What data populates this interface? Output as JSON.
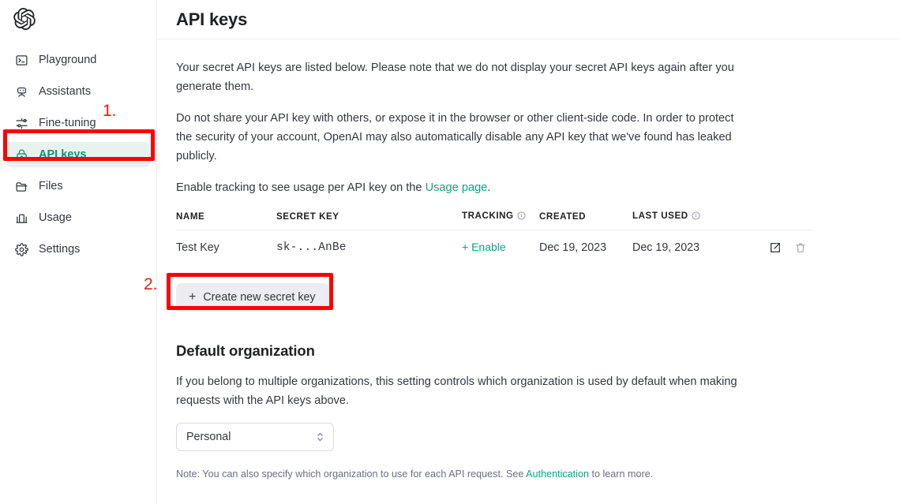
{
  "sidebar": {
    "brand_icon": "openai-logo",
    "items": [
      {
        "label": "Playground",
        "icon": "terminal-icon",
        "active": false
      },
      {
        "label": "Assistants",
        "icon": "robot-icon",
        "active": false
      },
      {
        "label": "Fine-tuning",
        "icon": "sliders-icon",
        "active": false
      },
      {
        "label": "API keys",
        "icon": "lock-icon",
        "active": true
      },
      {
        "label": "Files",
        "icon": "folder-icon",
        "active": false
      },
      {
        "label": "Usage",
        "icon": "bar-chart-icon",
        "active": false
      },
      {
        "label": "Settings",
        "icon": "gear-icon",
        "active": false
      }
    ]
  },
  "annotations": [
    {
      "number": "1.",
      "target": "sidebar-item-api-keys"
    },
    {
      "number": "2.",
      "target": "create-new-secret-key-button"
    }
  ],
  "header": {
    "title": "API keys"
  },
  "intro": {
    "paragraph1": "Your secret API keys are listed below. Please note that we do not display your secret API keys again after you generate them.",
    "paragraph2": "Do not share your API key with others, or expose it in the browser or other client-side code. In order to protect the security of your account, OpenAI may also automatically disable any API key that we've found has leaked publicly.",
    "paragraph3_prefix": "Enable tracking to see usage per API key on the ",
    "paragraph3_link": "Usage page",
    "paragraph3_suffix": "."
  },
  "table": {
    "columns": [
      "NAME",
      "SECRET KEY",
      "TRACKING",
      "CREATED",
      "LAST USED"
    ],
    "column_info_icons": {
      "tracking": "info-icon",
      "last_used": "info-icon"
    },
    "rows": [
      {
        "name": "Test Key",
        "secret_key": "sk-...AnBe",
        "tracking": "+ Enable",
        "created": "Dec 19, 2023",
        "last_used": "Dec 19, 2023",
        "actions": [
          "edit-icon",
          "delete-icon"
        ]
      }
    ]
  },
  "create_button": {
    "plus": "+",
    "label": "Create new secret key"
  },
  "default_org": {
    "heading": "Default organization",
    "description": "If you belong to multiple organizations, this setting controls which organization is used by default when making requests with the API keys above.",
    "select_value": "Personal",
    "note_prefix": "Note: You can also specify which organization to use for each API request. See ",
    "note_link": "Authentication",
    "note_suffix": " to learn more."
  },
  "colors": {
    "accent_green": "#10a37f",
    "active_nav_bg": "#e8f3ef",
    "active_nav_text": "#0f9373",
    "annotation_red": "#ff0000",
    "button_bg": "#ececf1"
  }
}
